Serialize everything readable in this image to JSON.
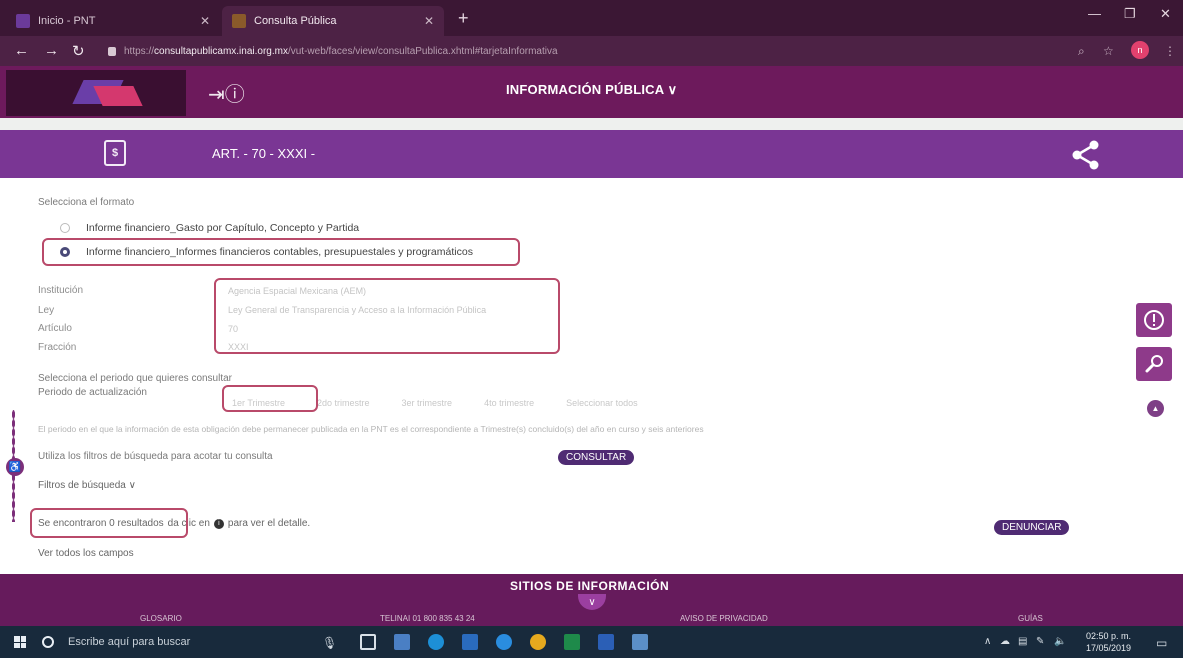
{
  "browser": {
    "tabs": [
      {
        "title": "Inicio - PNT"
      },
      {
        "title": "Consulta Pública"
      }
    ],
    "url": {
      "prefix": "https://",
      "domain": "consultapublicamx.inai.org.mx",
      "path": "/vut-web/faces/view/consultaPublica.xhtml#tarjetaInformativa"
    },
    "profile_initial": "n"
  },
  "site": {
    "nav_label": "INFORMACIÓN PÚBLICA ∨",
    "article_title": "ART. - 70 - XXXI -",
    "doc_icon_glyph": "$"
  },
  "form": {
    "format_label": "Selecciona el formato",
    "formats": [
      {
        "label": "Informe financiero_Gasto por Capítulo, Concepto y Partida",
        "selected": false
      },
      {
        "label": "Informe financiero_Informes financieros contables, presupuestales y programáticos",
        "selected": true
      }
    ],
    "fields": [
      {
        "label": "Institución",
        "value": "Agencia Espacial Mexicana (AEM)"
      },
      {
        "label": "Ley",
        "value": "Ley General de Transparencia y Acceso a la Información Pública"
      },
      {
        "label": "Artículo",
        "value": "70"
      },
      {
        "label": "Fracción",
        "value": "XXXI"
      }
    ],
    "period_prompt": "Selecciona el periodo que quieres consultar",
    "period_label": "Periodo de actualización",
    "periods": [
      "1er Trimestre",
      "2do trimestre",
      "3er trimestre",
      "4to trimestre",
      "Seleccionar todos"
    ],
    "period_note": "El periodo en el que la información de esta obligación debe permanecer publicada en la PNT es el correspondiente a Trimestre(s) concluido(s) del año en curso y seis anteriores",
    "filter_hint": "Utiliza los filtros de búsqueda para acotar tu consulta",
    "consult_button": "CONSULTAR",
    "filters_toggle": "Filtros de búsqueda ∨",
    "results_text": "Se encontraron 0 resultados",
    "results_detail": "da clic en",
    "results_detail_2": "para ver el detalle.",
    "denounce_button": "DENUNCIAR",
    "view_all": "Ver todos los campos"
  },
  "footer": {
    "title": "SITIOS DE INFORMACIÓN",
    "items": [
      "GLOSARIO",
      "TELINAI 01 800 835 43 24",
      "AVISO DE PRIVACIDAD",
      "GUÍAS"
    ]
  },
  "taskbar": {
    "search_placeholder": "Escribe aquí para buscar",
    "time": "02:50 p. m.",
    "date": "17/05/2019"
  },
  "colors": {
    "header_magenta": "#6d1a5c",
    "article_purple": "#7a3694",
    "highlight_red": "#b94a6a",
    "button_purple": "#4f2b73"
  }
}
